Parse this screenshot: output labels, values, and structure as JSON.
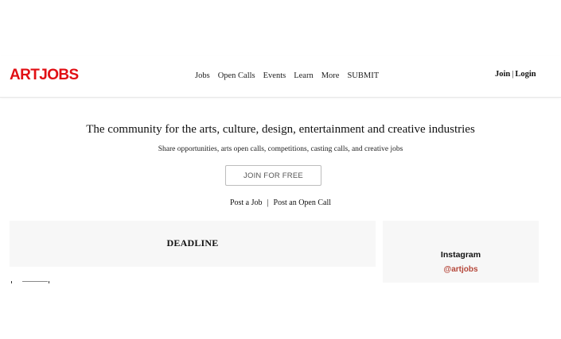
{
  "header": {
    "logo": "ARTJOBS",
    "nav": [
      "Jobs",
      "Open Calls",
      "Events",
      "Learn",
      "More",
      "SUBMIT"
    ],
    "auth": {
      "join": "Join",
      "separator": "|",
      "login": "Login"
    }
  },
  "hero": {
    "title": "The community for the arts, culture, design, entertainment and creative industries",
    "subtitle": "Share opportunities, arts open calls, competitions, casting calls, and creative jobs",
    "cta": "JOIN FOR FREE",
    "post_job": "Post a Job",
    "separator": "|",
    "post_open_call": "Post an Open Call"
  },
  "deadline": {
    "title": "DEADLINE"
  },
  "instagram": {
    "title": "Instagram",
    "handle": "@artjobs"
  },
  "colors": {
    "brand": "#e10f14",
    "handle": "#b5473a",
    "panel": "#f7f7f7"
  }
}
